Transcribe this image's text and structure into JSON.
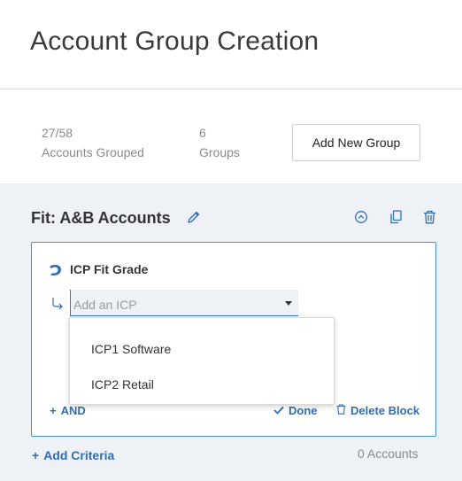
{
  "page": {
    "title": "Account Group Creation"
  },
  "stats": {
    "grouped_value": "27/58",
    "grouped_label": "Accounts Grouped",
    "groups_value": "6",
    "groups_label": "Groups",
    "add_new_group_label": "Add New Group"
  },
  "group": {
    "title": "Fit: A&B Accounts",
    "icons": [
      "pencil-icon",
      "collapse-up-icon",
      "copy-icon",
      "trash-icon"
    ]
  },
  "block": {
    "title": "ICP Fit Grade",
    "select": {
      "placeholder": "Add an ICP"
    },
    "dropdown_options": [
      "ICP1 Software",
      "ICP2 Retail"
    ],
    "and_label": "AND",
    "done_label": "Done",
    "delete_label": "Delete Block"
  },
  "footer": {
    "add_criteria_label": "Add Criteria",
    "accounts_count": "0 Accounts"
  },
  "colors": {
    "accent": "#2f6db5",
    "border_accent": "#4a90d9",
    "panel_bg": "#eef2f6"
  }
}
